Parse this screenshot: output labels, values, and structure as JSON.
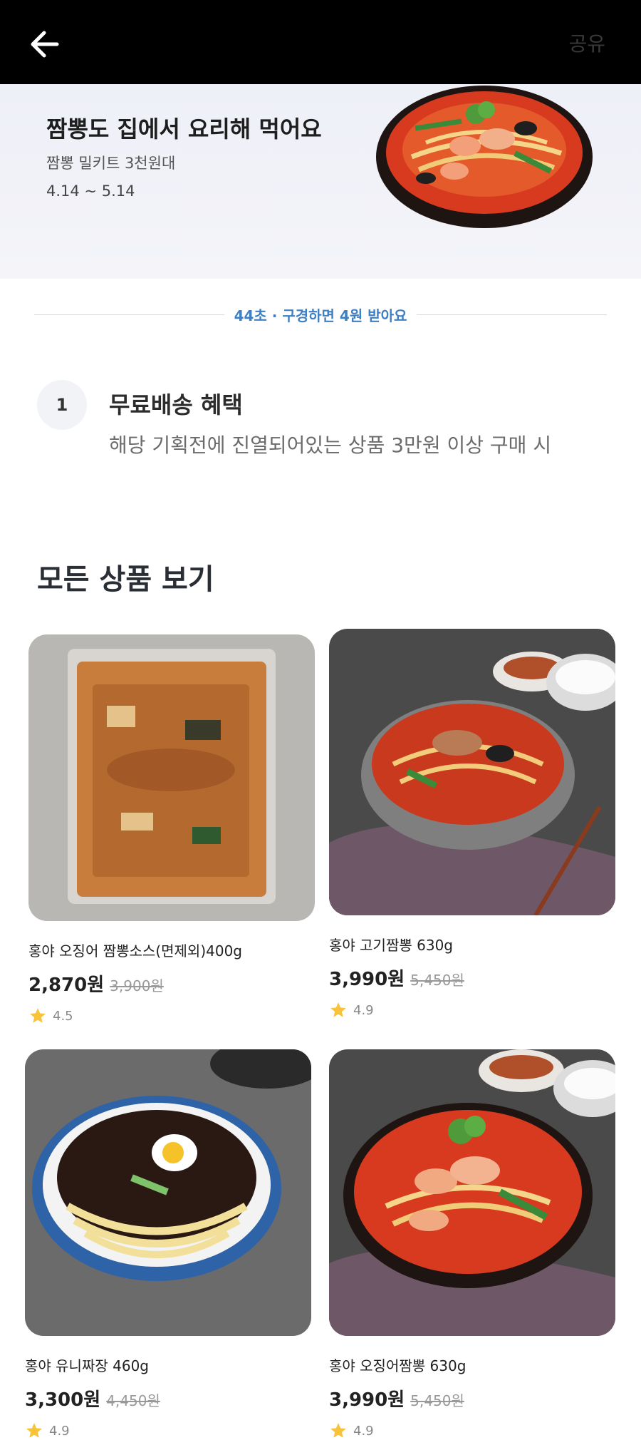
{
  "nav": {
    "share_label": "공유",
    "back_icon": "arrow-left-icon"
  },
  "hero": {
    "title": "짬뽕도 집에서 요리해 먹어요",
    "subtitle": "짬뽕 밀키트 3천원대",
    "date_range": "4.14 ~ 5.14"
  },
  "timer_text": "44초 · 구경하면 4원 받아요",
  "benefit": {
    "number": "1",
    "title": "무료배송 혜택",
    "description": "해당 기획전에 진열되어있는 상품 3만원 이상 구매 시"
  },
  "section_title": "모든 상품 보기",
  "products": [
    {
      "name": "홍야 오징어 짬뽕소스(면제외)400g",
      "price": "2,870원",
      "original_price": "3,900원",
      "rating": "4.5"
    },
    {
      "name": "홍야 고기짬뽕 630g",
      "price": "3,990원",
      "original_price": "5,450원",
      "rating": "4.9"
    },
    {
      "name": "홍야 유니짜장 460g",
      "price": "3,300원",
      "original_price": "4,450원",
      "rating": "4.9"
    },
    {
      "name": "홍야 오징어짬뽕 630g",
      "price": "3,990원",
      "original_price": "5,450원",
      "rating": "4.9"
    }
  ],
  "colors": {
    "accent_blue": "#3f7fc4",
    "star": "#f6c33b",
    "topbar": "#000000"
  }
}
